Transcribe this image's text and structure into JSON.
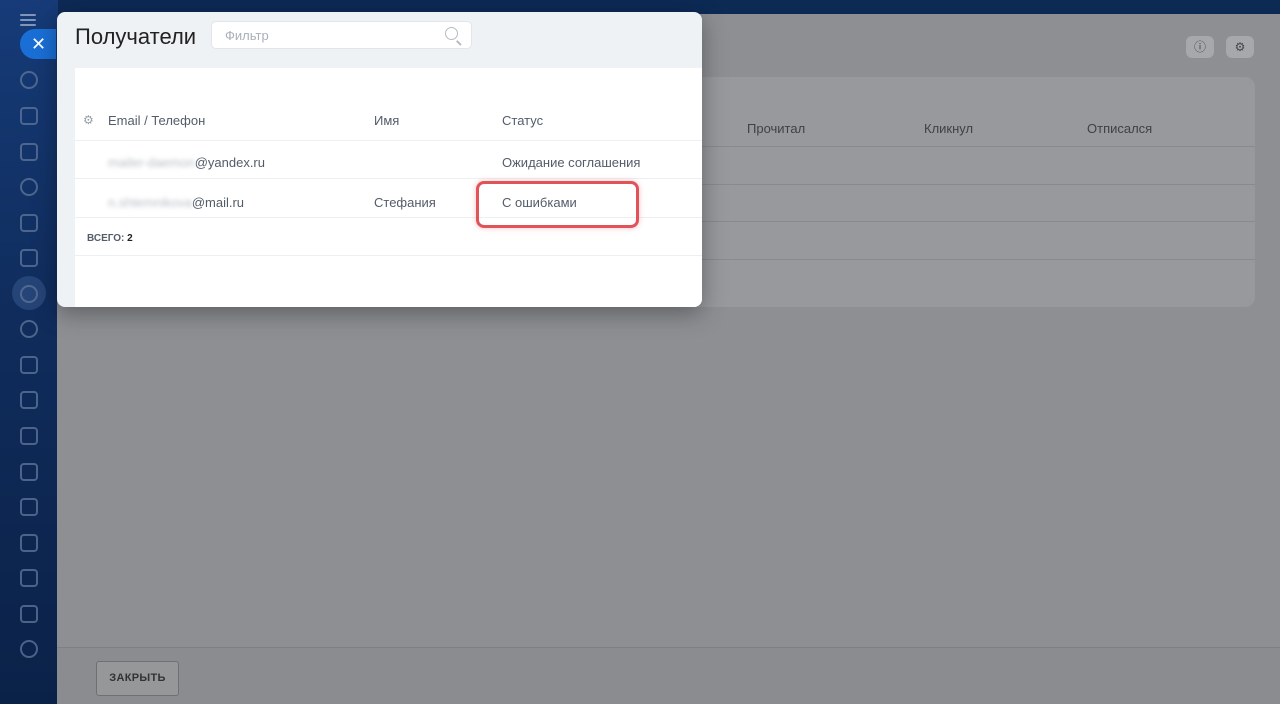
{
  "sidebar": {
    "icons": [
      "menu-icon",
      "close-icon",
      "chat-icon",
      "document-icon",
      "messages-icon",
      "contact-center-icon",
      "tasks-icon",
      "crm-icon",
      "marketing-icon",
      "users-icon",
      "edit-icon",
      "checkbox-icon",
      "calendar-icon",
      "robots-icon",
      "card-icon",
      "cart-icon",
      "file-icon",
      "more-icon",
      "settings-icon"
    ]
  },
  "background_table": {
    "columns": [
      "Прочитал",
      "Кликнул",
      "Отписался"
    ]
  },
  "footer": {
    "close_label": "ЗАКРЫТЬ"
  },
  "popup": {
    "title": "Получатели",
    "filter_placeholder": "Фильтр",
    "headers": {
      "email": "Email / Телефон",
      "name": "Имя",
      "status": "Статус"
    },
    "rows": [
      {
        "email_blurred": "mailer-daemon",
        "email_domain": "@yandex.ru",
        "name": "",
        "status": "Ожидание соглашения"
      },
      {
        "email_blurred": "n.shtemnikova",
        "email_domain": "@mail.ru",
        "name": "Стефания",
        "status": "С ошибками"
      }
    ],
    "total_label": "ВСЕГО:",
    "total_value": "2"
  },
  "highlight_color": "#e25259"
}
